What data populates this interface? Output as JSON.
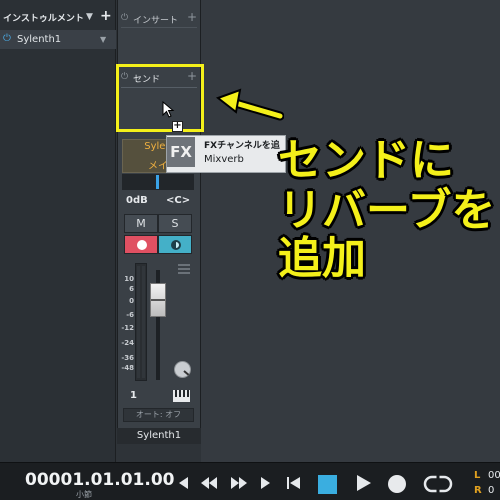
{
  "instrument_panel": {
    "title": "インストゥルメント",
    "add_symbol": "+",
    "dropdown_symbol": "▼",
    "items": [
      {
        "name": "Sylenth1"
      }
    ]
  },
  "channel": {
    "insert_label": "インサート",
    "send_label": "センド",
    "add_symbol": "+",
    "output_name": "Sylen",
    "output_main": "メイ",
    "volume": "0dB",
    "pan": "<C>",
    "mute_label": "M",
    "solo_label": "S",
    "meter_scale": [
      "10",
      "6",
      "0",
      "-6",
      "-12",
      "-24",
      "-36",
      "-48"
    ],
    "fader_level_db": 0,
    "channel_number": "1",
    "automation": "オート: オフ",
    "name": "Sylenth1"
  },
  "popup": {
    "badge": "FX",
    "title": "FXチャンネルを追",
    "item": "Mixverb"
  },
  "annotation": {
    "line1": "センドに",
    "line2": "リバーブを",
    "line3": "追加",
    "color": "#f4f01a"
  },
  "transport": {
    "time": "00001.01.01.00",
    "time_unit": "小節",
    "l_label": "L",
    "r_label": "R",
    "l_value": "00",
    "r_value": "0"
  },
  "colors": {
    "accent_blue": "#3aaee0",
    "record_red": "#e05062",
    "monitor_cyan": "#44b0c8",
    "output_orange": "#f0b040"
  }
}
